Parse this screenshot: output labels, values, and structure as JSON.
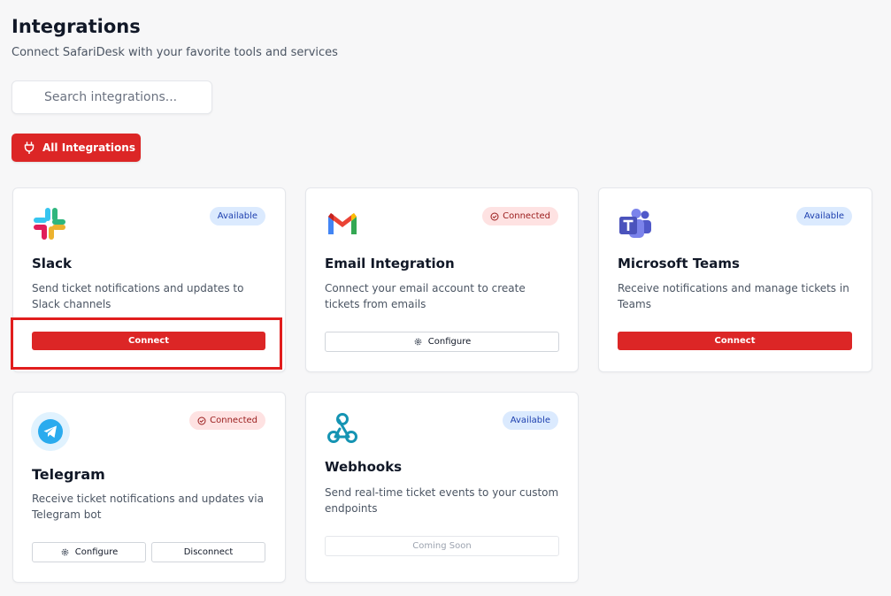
{
  "header": {
    "title": "Integrations",
    "subtitle": "Connect SafariDesk with your favorite tools and services"
  },
  "search": {
    "placeholder": "Search integrations..."
  },
  "filters": {
    "all_label": "All Integrations"
  },
  "integrations": [
    {
      "name": "Slack",
      "status": "Available",
      "description": "Send ticket notifications and updates to Slack channels",
      "actions": [
        "Connect"
      ]
    },
    {
      "name": "Email Integration",
      "status": "Connected",
      "description": "Connect your email account to create tickets from emails",
      "actions": [
        "Configure"
      ]
    },
    {
      "name": "Microsoft Teams",
      "status": "Available",
      "description": "Receive notifications and manage tickets in Teams",
      "actions": [
        "Connect"
      ]
    },
    {
      "name": "Telegram",
      "status": "Connected",
      "description": "Receive ticket notifications and updates via Telegram bot",
      "actions": [
        "Configure",
        "Disconnect"
      ]
    },
    {
      "name": "Webhooks",
      "status": "Available",
      "description": "Send real-time ticket events to your custom endpoints",
      "actions": [
        "Coming Soon"
      ]
    }
  ],
  "icons": {
    "slack": "slack-logo-icon",
    "email": "gmail-logo-icon",
    "teams": "teams-logo-icon",
    "telegram": "telegram-logo-icon",
    "webhooks": "webhook-icon",
    "configure": "gear-icon",
    "connected": "check-circle-icon",
    "all": "plug-icon"
  },
  "colors": {
    "accent": "#dc2626",
    "available_badge_bg": "#dbeafe",
    "available_badge_text": "#1e40af",
    "connected_badge_bg": "#fee2e2",
    "connected_badge_text": "#991b1b",
    "highlight": "#e11d1d"
  }
}
